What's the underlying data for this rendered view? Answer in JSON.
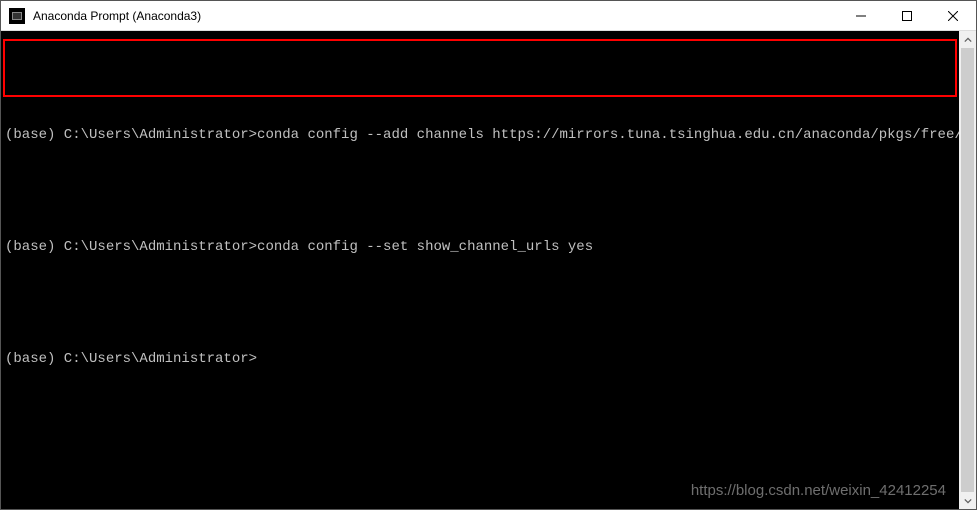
{
  "titlebar": {
    "title": "Anaconda Prompt (Anaconda3)"
  },
  "terminal": {
    "lines": [
      "",
      "(base) C:\\Users\\Administrator>conda config --add channels https://mirrors.tuna.tsinghua.edu.cn/anaconda/pkgs/free/",
      "",
      "(base) C:\\Users\\Administrator>conda config --set show_channel_urls yes",
      "",
      "(base) C:\\Users\\Administrator>"
    ]
  },
  "watermark": "https://blog.csdn.net/weixin_42412254"
}
